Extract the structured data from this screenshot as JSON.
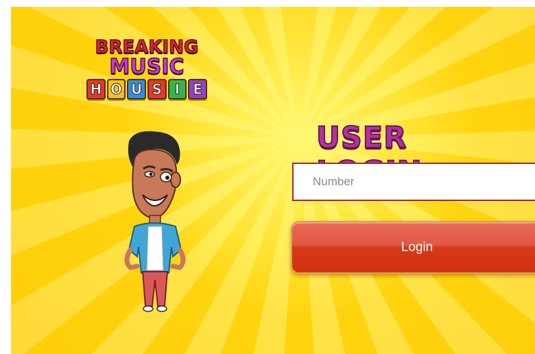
{
  "logo": {
    "line1": "BREAKING",
    "line2": "MUSIC",
    "tiles": [
      "H",
      "O",
      "U",
      "S",
      "I",
      "E"
    ],
    "tile_colors": [
      "#e03a2a",
      "#f4c21a",
      "#2d8fe0",
      "#e03a2a",
      "#2fb84a",
      "#8e44c8"
    ]
  },
  "login": {
    "title": "USER LOGIN:",
    "number_placeholder": "Number",
    "number_value": "",
    "button_label": "Login"
  },
  "colors": {
    "background": "#ffde22",
    "title": "#b3339a",
    "button": "#d63a1a",
    "input_border": "#a4283a"
  },
  "icons": {
    "character": "cartoon-man-illustration"
  }
}
